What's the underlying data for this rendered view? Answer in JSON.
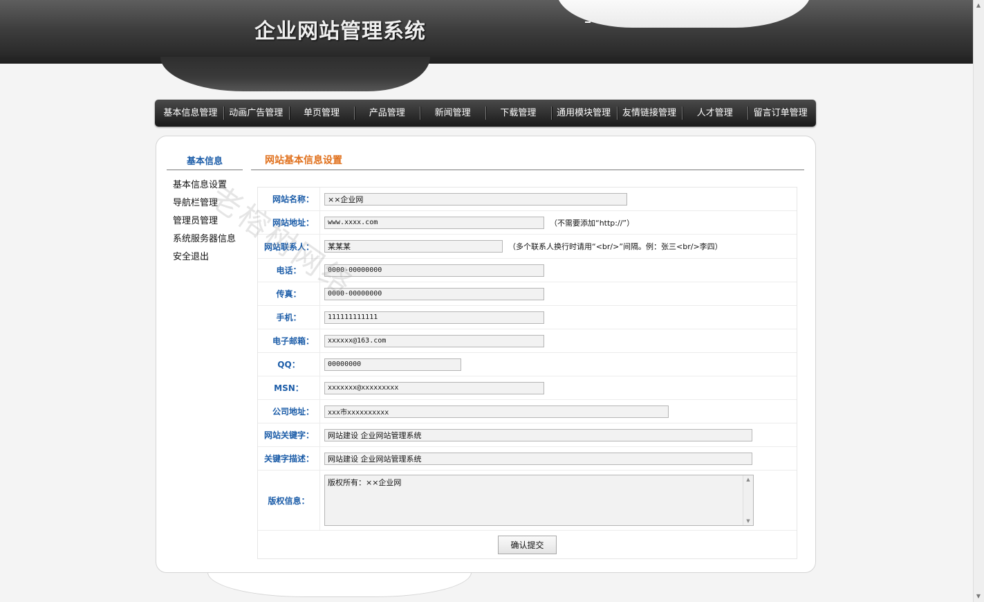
{
  "header": {
    "title": "企业网站管理系统"
  },
  "nav": [
    "基本信息管理",
    "动画广告管理",
    "单页管理",
    "产品管理",
    "新闻管理",
    "下载管理",
    "通用模块管理",
    "友情链接管理",
    "人才管理",
    "留言订单管理"
  ],
  "sidebar": {
    "title": "基本信息",
    "items": [
      "基本信息设置",
      "导航栏管理",
      "管理员管理",
      "系统服务器信息",
      "安全退出"
    ]
  },
  "main": {
    "title": "网站基本信息设置"
  },
  "form": {
    "site_name": {
      "label": "网站名称：",
      "value": "××企业网"
    },
    "site_url": {
      "label": "网站地址：",
      "value": "www.xxxx.com",
      "hint": "（不需要添加“http://”）"
    },
    "contact": {
      "label": "网站联系人：",
      "value": "某某某",
      "hint": "（多个联系人换行时请用“<br/>”间隔。例：张三<br/>李四）"
    },
    "phone": {
      "label": "电话：",
      "value": "0000-00000000"
    },
    "fax": {
      "label": "传真：",
      "value": "0000-00000000"
    },
    "mobile": {
      "label": "手机：",
      "value": "111111111111"
    },
    "email": {
      "label": "电子邮箱：",
      "value": "xxxxxx@163.com"
    },
    "qq": {
      "label": "QQ：",
      "value": "00000000"
    },
    "msn": {
      "label": "MSN：",
      "value": "xxxxxxx@xxxxxxxxx"
    },
    "address": {
      "label": "公司地址：",
      "value": "xxx市xxxxxxxxxx"
    },
    "keywords": {
      "label": "网站关键字：",
      "value": "网站建设 企业网站管理系统"
    },
    "description": {
      "label": "关键字描述：",
      "value": "网站建设 企业网站管理系统"
    },
    "copyright": {
      "label": "版权信息：",
      "value": "版权所有：××企业网"
    },
    "submit_label": "确认提交"
  },
  "watermark": "老榕树网络",
  "scrollbar": {
    "up": "▲",
    "down": "▼"
  }
}
